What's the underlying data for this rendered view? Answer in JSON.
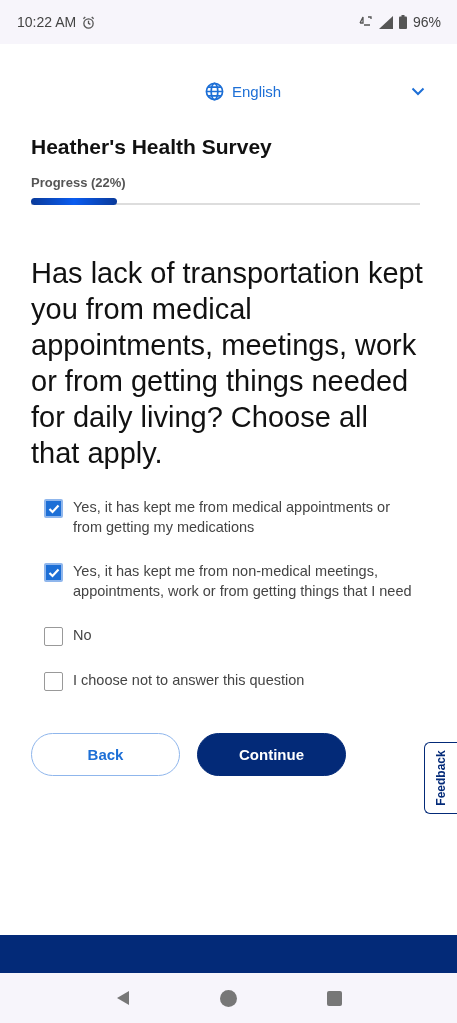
{
  "status_bar": {
    "time": "10:22 AM",
    "battery": "96%"
  },
  "language": {
    "label": "English"
  },
  "survey_title": "Heather's Health Survey",
  "progress": {
    "label": "Progress (22%)",
    "level": 0.22
  },
  "question": "Has lack of transportation kept you from medical appointments, meetings, work or from getting things needed for daily living? Choose all that apply.",
  "options": [
    {
      "label": "Yes, it has kept me from medical appointments or from getting my medications",
      "checked": true
    },
    {
      "label": "Yes, it has kept me from non-medical meetings, appointments, work or from getting things that I need",
      "checked": true
    },
    {
      "label": "No",
      "checked": false
    },
    {
      "label": "I choose not to answer this question",
      "checked": false
    }
  ],
  "buttons": [
    {
      "label": "Back",
      "kind": "secondary"
    },
    {
      "label": "Continue",
      "kind": "primary"
    }
  ],
  "feedback_tab": "Feedback"
}
